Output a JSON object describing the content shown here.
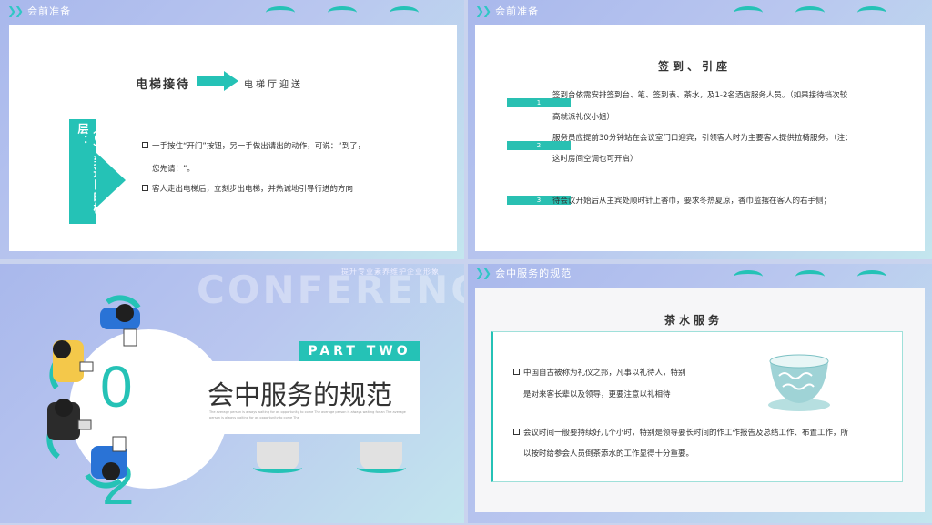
{
  "slide1": {
    "header": "会前准备",
    "title": "电梯接待",
    "subtitle": "电梯厅迎送",
    "side_label": "（3）到达目的楼层：",
    "bullets": [
      {
        "line1": "一手按住“开门”按钮，另一手做出请出的动作，可说：“到了，",
        "line2": "您先请！”。"
      },
      {
        "line1": "客人走出电梯后，立刻步出电梯，并热诚地引导行进的方向",
        "line2": ""
      }
    ]
  },
  "slide2": {
    "header": "会前准备",
    "title": "签到、引座",
    "items": [
      {
        "num": "1",
        "line1": "签到台依需安排签到台、笔、签到表、茶水，及1-2名酒店服务人员。（如果接待档次较",
        "line2": "高就派礼仪小姐）"
      },
      {
        "num": "2",
        "line1": "服务员应提前30分钟站在会议室门口迎宾，引领客人时为主要客人提供拉椅服务。（注：",
        "line2": "这时房间空调也可开启）"
      },
      {
        "num": "3",
        "line1": "待会议开始后从主宾处顺时针上香巾，要求冬热夏凉，香巾监摆在客人的右手侧；",
        "line2": ""
      }
    ]
  },
  "slide3": {
    "slogan": "提升专业素养维护企业形象",
    "watermark": "CONFERENCE",
    "part_label": "PART TWO",
    "number_top": "0",
    "number_bottom": "2",
    "title": "会中服务的规范",
    "small_text": "The average person is always waiting for an opportunity to come The average person is always waiting for an The average person is always waiting for an opportunity to come The"
  },
  "slide4": {
    "header": "会中服务的规范",
    "title": "茶水服务",
    "bullets": [
      {
        "line1": "中国自古被称为礼仪之邦，凡事以礼待人，特别",
        "line2": "是对来客长辈以及领导，更要注意以礼相待"
      },
      {
        "line1": "会议时间一般要持续好几个小时，特别是领导要长时间的作工作报告及总结工作、布置工作，所",
        "line2": "以按时给参会人员倒茶添水的工作显得十分重要。"
      }
    ]
  },
  "colors": {
    "accent": "#25c2b6",
    "header_text": "#ffffff",
    "body_text": "#333333"
  }
}
